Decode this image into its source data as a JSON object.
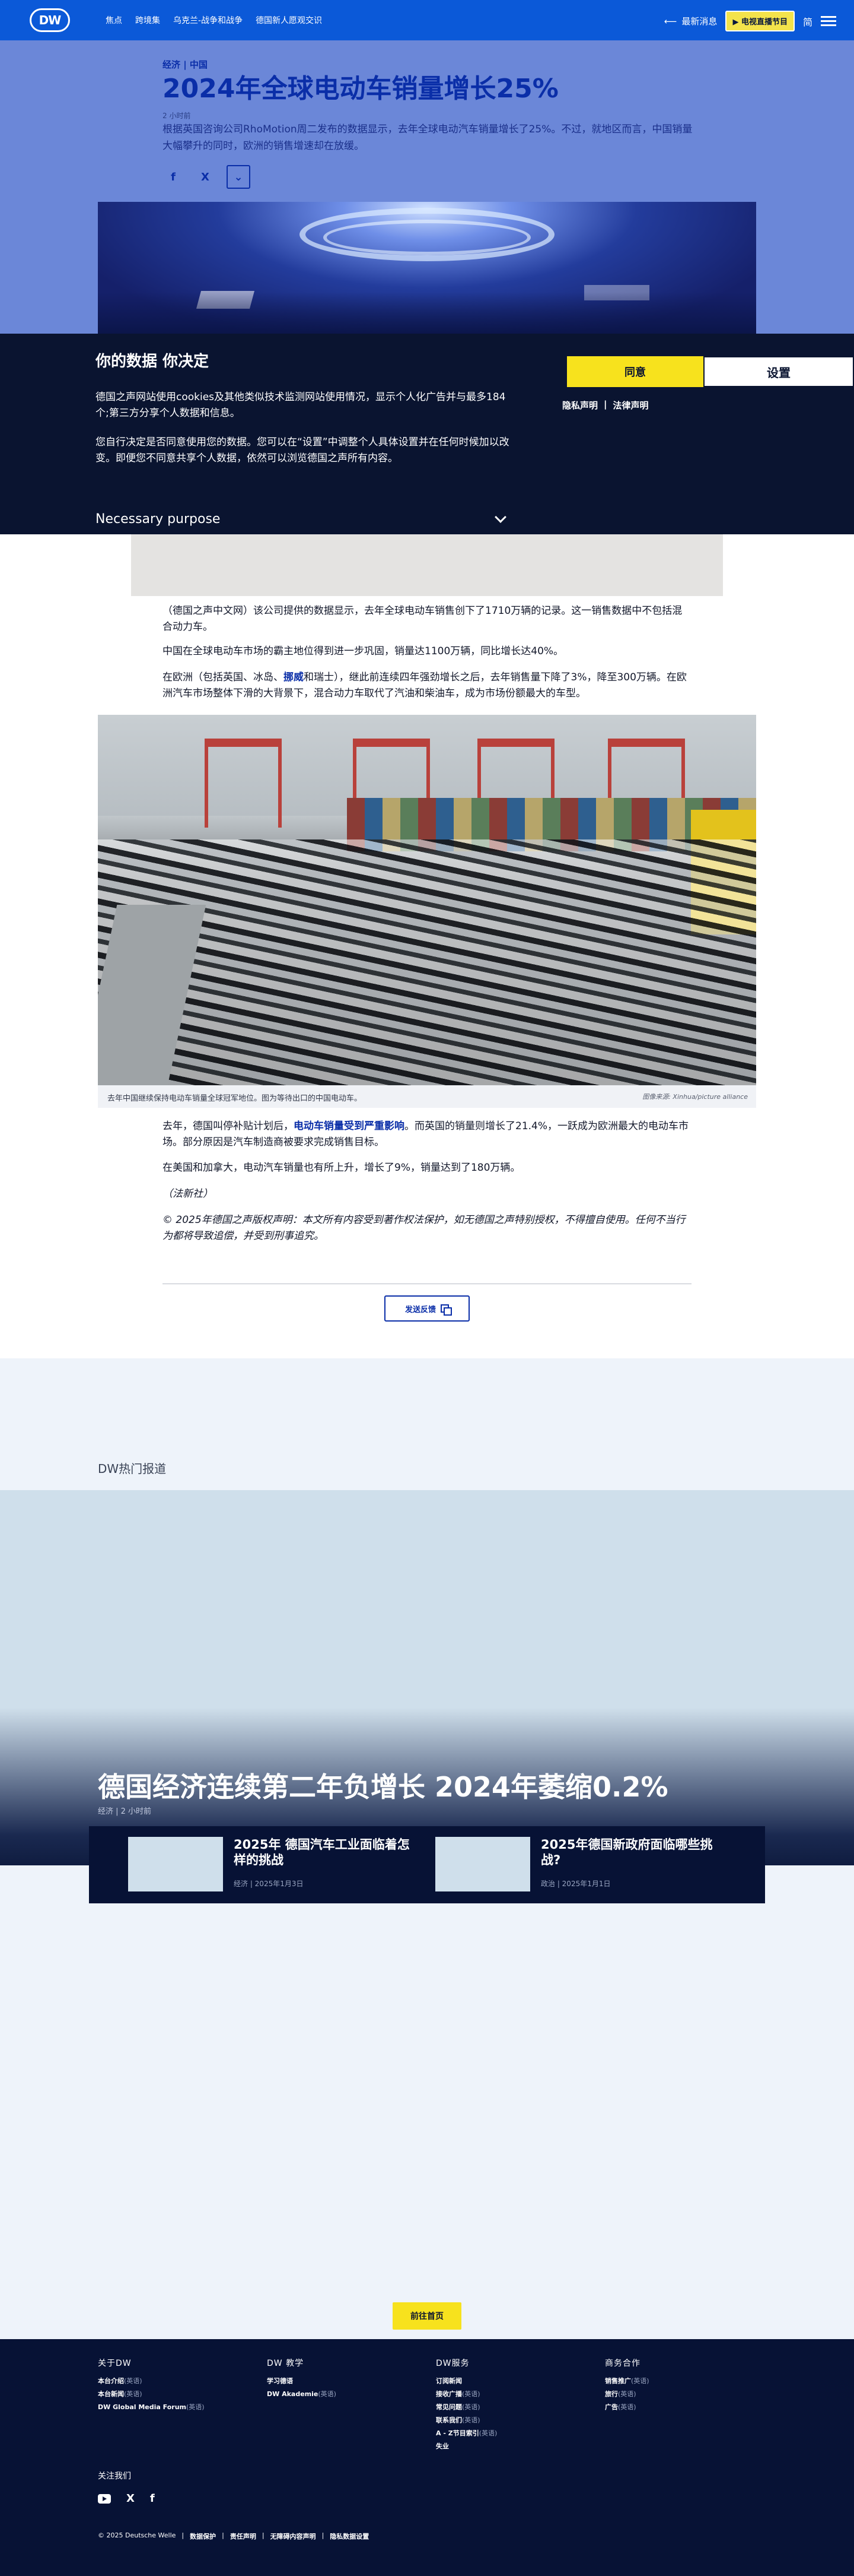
{
  "nav": {
    "logo": "DW",
    "links": [
      "焦点",
      "跨境集",
      "乌克兰-战争和战争",
      "德国新人愿观交识"
    ],
    "news_label": "最新消息",
    "live_label": "电视直播节目",
    "lang_label": "简"
  },
  "article": {
    "kicker": "经济 | 中国",
    "title": "2024年全球电动车销量增长25%",
    "time": "2 小时前",
    "lead": "根据英国咨询公司RhoMotion周二发布的数据显示，去年全球电动汽车销量增长了25%。不过，就地区而言，中国销量大幅攀升的同时，欧洲的销售增速却在放缓。",
    "share": {
      "facebook": "f",
      "x": "X",
      "more": "⌄"
    },
    "paragraphs": {
      "p1": "（德国之声中文网）该公司提供的数据显示，去年全球电动车销售创下了1710万辆的记录。这一销售数据中不包括混合动力车。",
      "p2": "中国在全球电动车市场的霸主地位得到进一步巩固，销量达1100万辆，同比增长达40%。",
      "p3a": "在欧洲（包括英国、冰岛、",
      "p3link": "挪威",
      "p3b": "和瑞士），继此前连续四年强劲增长之后，去年销售量下降了3%，降至300万辆。在欧洲汽车市场整体下滑的大背景下，混合动力车取代了汽油和柴油车，成为市场份额最大的车型。",
      "p4a": "去年，德国叫停补贴计划后，",
      "p4link": "电动车销量受到严重影响",
      "p4b": "。而英国的销量则增长了21.4%，一跃成为欧洲最大的电动车市场。部分原因是汽车制造商被要求完成销售目标。",
      "p5": "在美国和加拿大，电动汽车销量也有所上升，增长了9%，销量达到了180万辆。",
      "p6": "（法新社）",
      "p7": "© 2025年德国之声版权声明：本文所有内容受到著作权法保护，如无德国之声特别授权，不得擅自使用。任何不当行为都将导致追偿，并受到刑事追究。"
    },
    "caption": "去年中国继续保持电动车销量全球冠军地位。图为等待出口的中国电动车。",
    "credit": "图像来源: Xinhua/picture alliance",
    "feedback_label": "发送反馈"
  },
  "cookie": {
    "title": "你的数据 你决定",
    "p1": "德国之声网站使用cookies及其他类似技术监测网站使用情况，显示个人化广告并与最多184 个;第三方分享个人数据和信息。",
    "p2": "您自行决定是否同意使用您的数据。您可以在“设置”中调整个人具体设置并在任何时候加以改变。即便您不同意共享个人数据，依然可以浏览德国之声所有内容。",
    "accept_label": "同意",
    "settings_label": "设置",
    "privacy_link": "隐私声明",
    "legal_link": "法律声明",
    "purpose_label": "Necessary purpose"
  },
  "trending": {
    "label": "DW热门报道",
    "feature_title": "德国经济连续第二年负增长 2024年萎缩0.2%",
    "feature_meta": "经济 | 2 小时前",
    "cards": [
      {
        "title": "2025年 德国汽车工业面临着怎样的挑战",
        "meta": "经济 | 2025年1月3日"
      },
      {
        "title": "2025年德国新政府面临哪些挑战?",
        "meta": "政治 | 2025年1月1日"
      }
    ],
    "home_label": "前往首页"
  },
  "footer": {
    "columns": [
      {
        "heading": "关于DW",
        "items": [
          {
            "label": "本台介绍",
            "tag": "(英语)"
          },
          {
            "label": "本台新闻",
            "tag": "(英语)"
          },
          {
            "label": "DW Global Media Forum",
            "tag": "(英语)"
          }
        ]
      },
      {
        "heading": "DW 教学",
        "items": [
          {
            "label": "学习德语",
            "tag": ""
          },
          {
            "label": "DW Akademie",
            "tag": "(英语)"
          }
        ]
      },
      {
        "heading": "DW服务",
        "items": [
          {
            "label": "订阅新闻",
            "tag": ""
          },
          {
            "label": "接收广播",
            "tag": "(英语)"
          },
          {
            "label": "常见问题",
            "tag": "(英语)"
          },
          {
            "label": "联系我们",
            "tag": "(英语)"
          },
          {
            "label": "A - Z节目索引",
            "tag": "(英语)"
          },
          {
            "label": "失业",
            "tag": ""
          }
        ]
      },
      {
        "heading": "商务合作",
        "items": [
          {
            "label": "销售推广",
            "tag": "(英语)"
          },
          {
            "label": "旅行",
            "tag": "(英语)"
          },
          {
            "label": "广告",
            "tag": "(英语)"
          }
        ]
      }
    ],
    "follow_label": "关注我们",
    "social": {
      "x": "X",
      "facebook": "f"
    },
    "legal": [
      "© 2025 Deutsche Welle",
      "数据保护",
      "责任声明",
      "无障碍内容声明",
      "隐私数据设置"
    ]
  }
}
